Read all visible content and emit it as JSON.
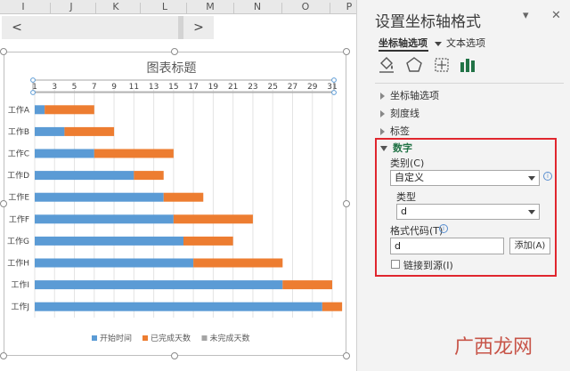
{
  "sheet": {
    "columns": [
      "I",
      "J",
      "K",
      "L",
      "M",
      "N",
      "O",
      "P"
    ],
    "scroll_left": "<",
    "scroll_right": ">"
  },
  "chart_data": {
    "type": "bar",
    "orientation": "horizontal-stacked",
    "title": "图表标题",
    "categories": [
      "工作A",
      "工作B",
      "工作C",
      "工作D",
      "工作E",
      "工作F",
      "工作G",
      "工作H",
      "工作I",
      "工作J"
    ],
    "series": [
      {
        "name": "开始时间",
        "color": "#5b9bd5",
        "values": [
          1,
          3,
          6,
          10,
          13,
          14,
          15,
          16,
          25,
          29
        ]
      },
      {
        "name": "已完成天数",
        "color": "#ed7d31",
        "values": [
          5,
          5,
          8,
          3,
          4,
          8,
          5,
          9,
          5,
          2
        ]
      },
      {
        "name": "未完成天数",
        "color": "#a5a5a5",
        "values": [
          0,
          0,
          0,
          0,
          0,
          0,
          0,
          0,
          0,
          0
        ]
      }
    ],
    "x_ticks": [
      "1",
      "3",
      "5",
      "7",
      "9",
      "11",
      "13",
      "15",
      "17",
      "19",
      "21",
      "23",
      "25",
      "27",
      "29",
      "31"
    ],
    "xlim": [
      1,
      31
    ],
    "x_axis_position": "top",
    "grid": true,
    "legend": "bottom"
  },
  "pane": {
    "title": "设置坐标轴格式",
    "dropdown_glyph": "▾",
    "close_glyph": "✕",
    "tab_axis_options": "坐标轴选项",
    "tab_text_options": "文本选项",
    "sections": {
      "axis_options": "坐标轴选项",
      "tick_marks": "刻度线",
      "labels": "标签",
      "number": "数字"
    },
    "number": {
      "category_label": "类别(C)",
      "category_value": "自定义",
      "type_label": "类型",
      "type_value": "d",
      "format_code_label": "格式代码(T)",
      "format_code_value": "d",
      "add_button": "添加(A)",
      "link_to_source": "链接到源(I)"
    },
    "accent_color": "#217346",
    "highlight_color": "#e0262e"
  },
  "watermark": "广西龙网"
}
